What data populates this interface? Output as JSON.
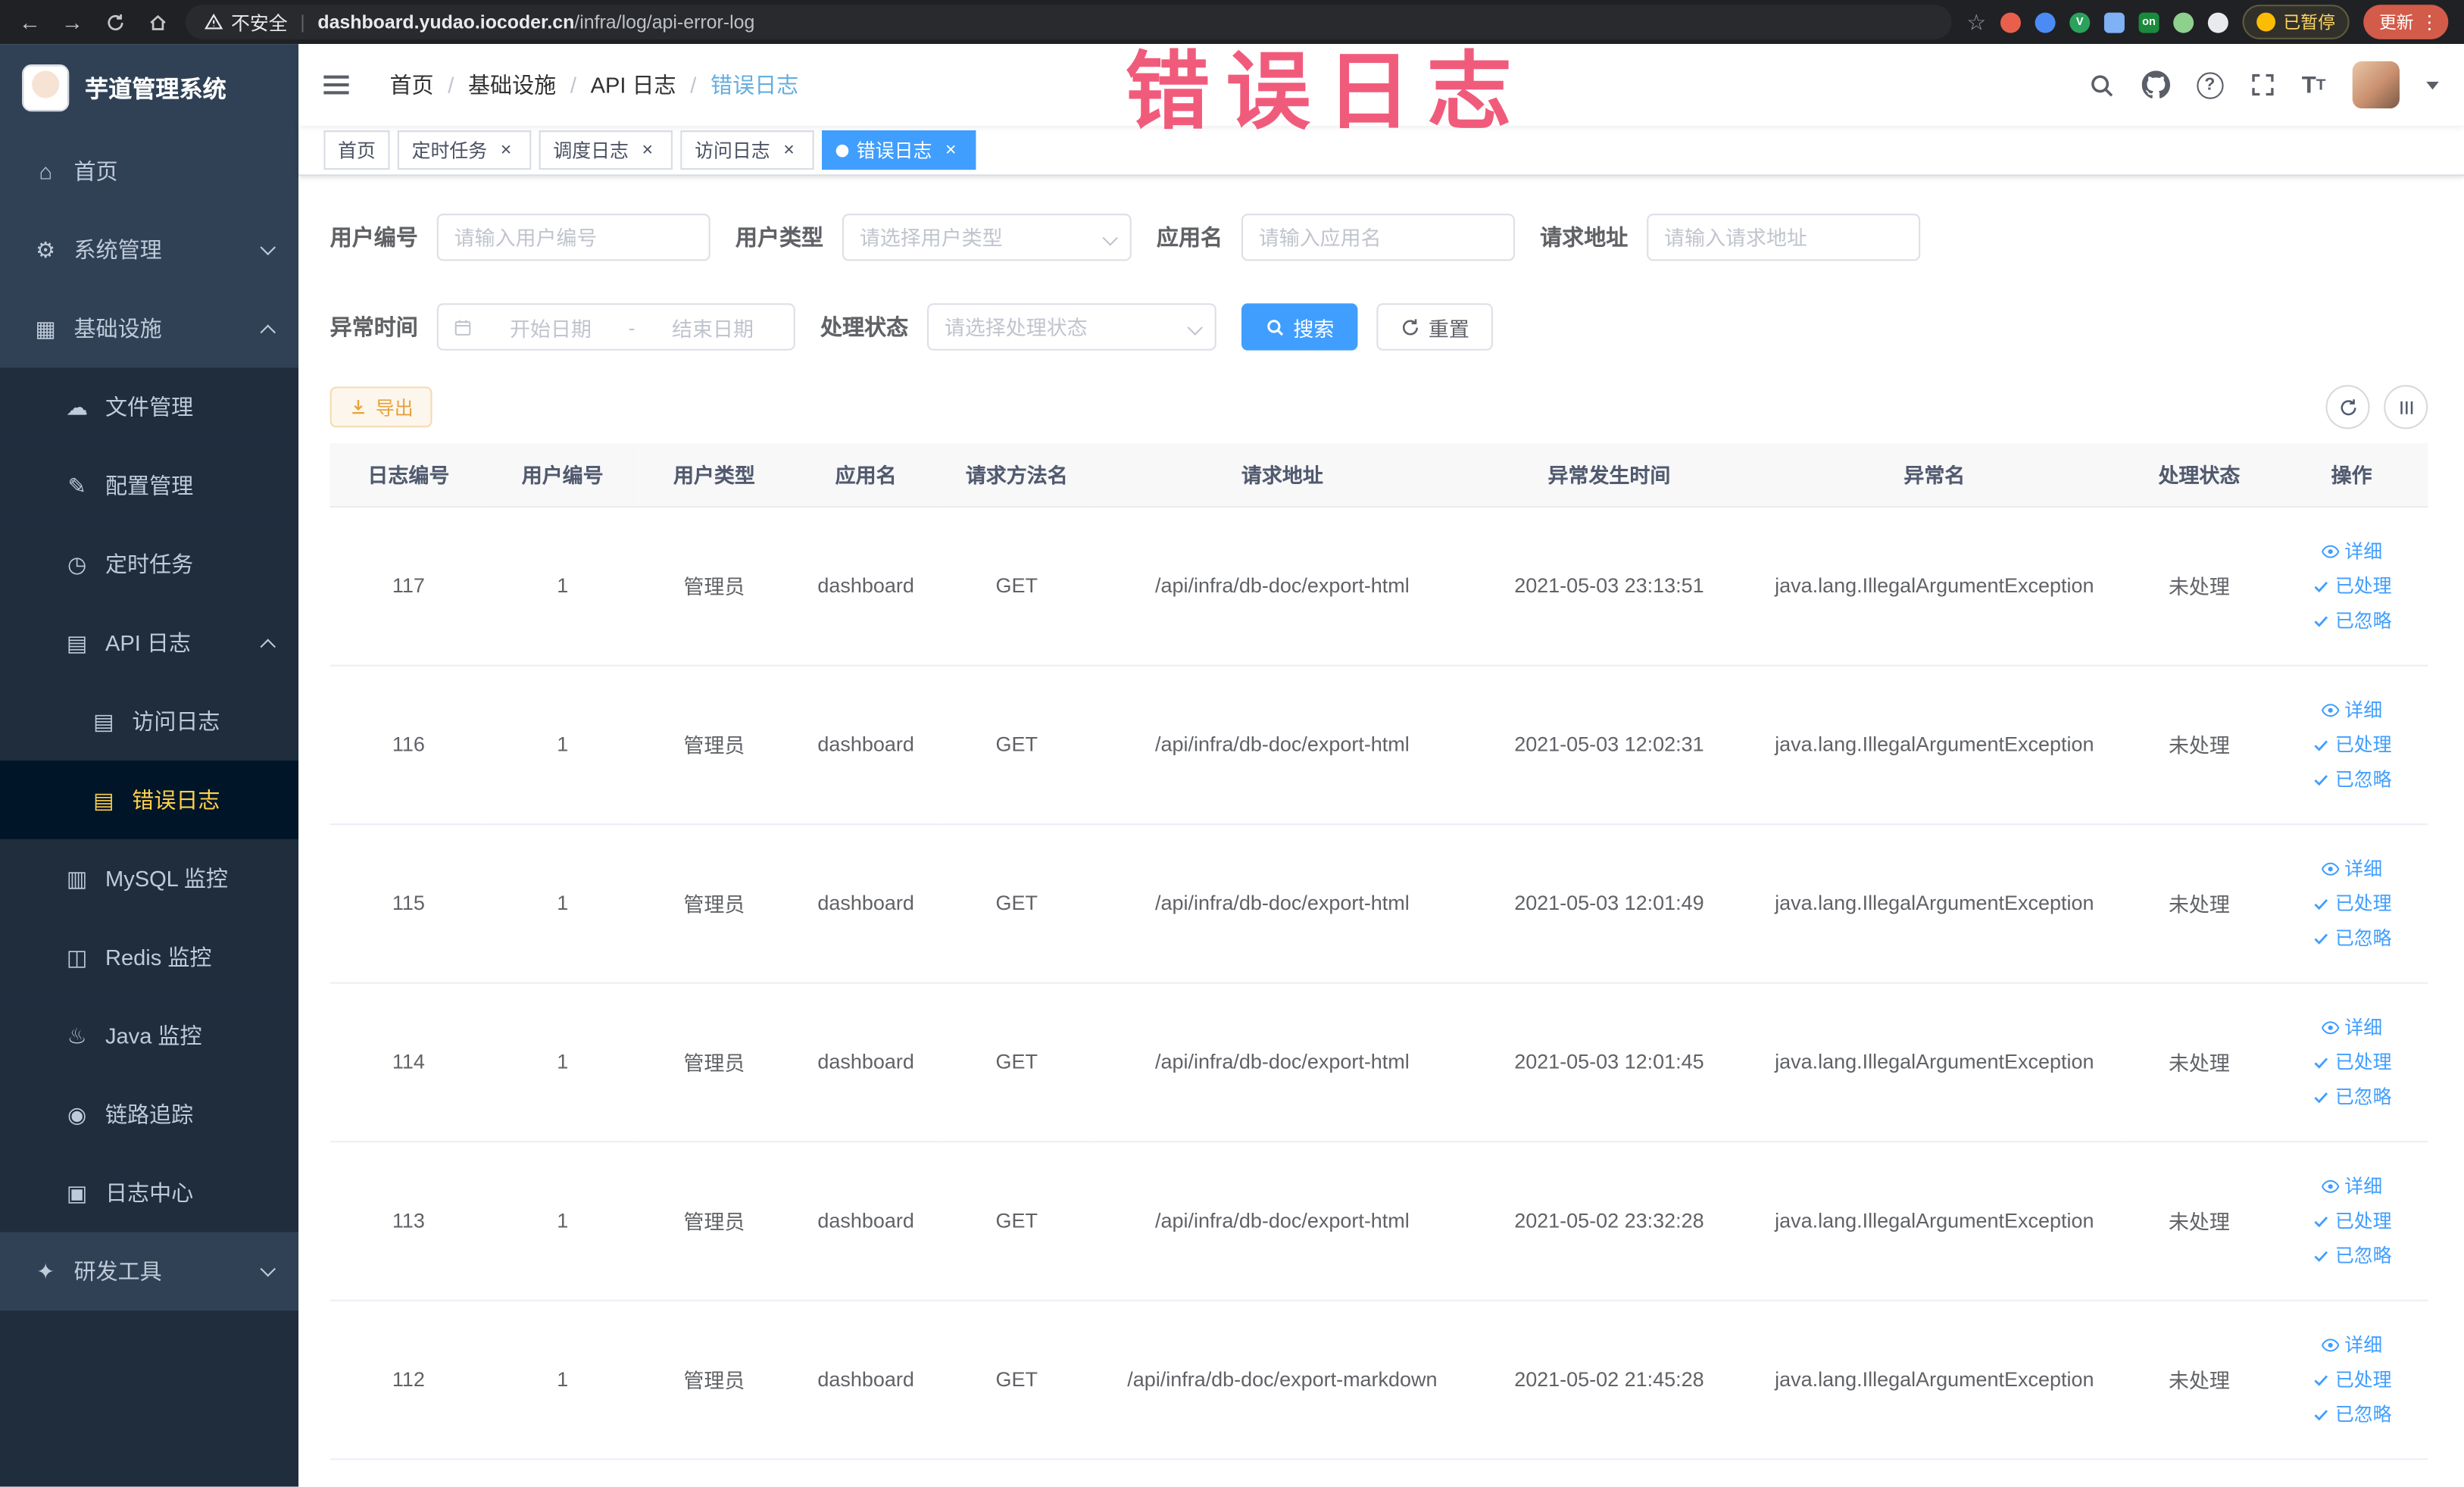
{
  "browser": {
    "security_label": "不安全",
    "url_host": "dashboard.yudao.iocoder.cn",
    "url_path": "/infra/log/api-error-log",
    "paused_chip": "已暂停",
    "update_button": "更新"
  },
  "overlay": {
    "title": "错误日志"
  },
  "app": {
    "title": "芋道管理系统"
  },
  "sidebar": {
    "items": [
      {
        "slug": "home",
        "label": "首页",
        "icon": "home-icon",
        "level": 0
      },
      {
        "slug": "system-management",
        "label": "系统管理",
        "icon": "gear-icon",
        "level": 0,
        "chevron": "down"
      },
      {
        "slug": "infrastructure",
        "label": "基础设施",
        "icon": "infrastructure-icon",
        "level": 0,
        "chevron": "up"
      },
      {
        "slug": "file-management",
        "label": "文件管理",
        "icon": "file-icon",
        "level": 1
      },
      {
        "slug": "config-management",
        "label": "配置管理",
        "icon": "config-icon",
        "level": 1
      },
      {
        "slug": "scheduled-jobs",
        "label": "定时任务",
        "icon": "timer-icon",
        "level": 1
      },
      {
        "slug": "api-logs",
        "label": "API 日志",
        "icon": "api-log-icon",
        "level": 1,
        "chevron": "up"
      },
      {
        "slug": "access-logs",
        "label": "访问日志",
        "icon": "access-log-icon",
        "level": 2
      },
      {
        "slug": "error-logs",
        "label": "错误日志",
        "icon": "error-log-icon",
        "level": 2,
        "active": true
      },
      {
        "slug": "mysql-monitor",
        "label": "MySQL 监控",
        "icon": "mysql-icon",
        "level": 1
      },
      {
        "slug": "redis-monitor",
        "label": "Redis 监控",
        "icon": "redis-icon",
        "level": 1
      },
      {
        "slug": "java-monitor",
        "label": "Java 监控",
        "icon": "java-icon",
        "level": 1
      },
      {
        "slug": "trace",
        "label": "链路追踪",
        "icon": "trace-icon",
        "level": 1
      },
      {
        "slug": "log-center",
        "label": "日志中心",
        "icon": "log-center-icon",
        "level": 1
      },
      {
        "slug": "dev-tools",
        "label": "研发工具",
        "icon": "tools-icon",
        "level": 0,
        "chevron": "down"
      }
    ]
  },
  "header": {
    "breadcrumb": [
      "首页",
      "基础设施",
      "API 日志",
      "错误日志"
    ],
    "breadcrumb_separator": "/"
  },
  "tags": [
    {
      "slug": "home",
      "label": "首页",
      "closable": false,
      "active": false
    },
    {
      "slug": "scheduled-jobs",
      "label": "定时任务",
      "closable": true,
      "active": false
    },
    {
      "slug": "schedule-logs",
      "label": "调度日志",
      "closable": true,
      "active": false
    },
    {
      "slug": "access-logs",
      "label": "访问日志",
      "closable": true,
      "active": false
    },
    {
      "slug": "error-logs",
      "label": "错误日志",
      "closable": true,
      "active": true
    }
  ],
  "filters": {
    "user_id": {
      "label": "用户编号",
      "placeholder": "请输入用户编号"
    },
    "user_type": {
      "label": "用户类型",
      "placeholder": "请选择用户类型"
    },
    "app_name": {
      "label": "应用名",
      "placeholder": "请输入应用名"
    },
    "request_url": {
      "label": "请求地址",
      "placeholder": "请输入请求地址"
    },
    "exception_time": {
      "label": "异常时间",
      "start_placeholder": "开始日期",
      "separator": "-",
      "end_placeholder": "结束日期"
    },
    "process_status": {
      "label": "处理状态",
      "placeholder": "请选择处理状态"
    },
    "search_button": "搜索",
    "reset_button": "重置"
  },
  "toolbar": {
    "export_button": "导出"
  },
  "table": {
    "columns": [
      "日志编号",
      "用户编号",
      "用户类型",
      "应用名",
      "请求方法名",
      "请求地址",
      "异常发生时间",
      "异常名",
      "处理状态",
      "操作"
    ],
    "row_actions": [
      "详细",
      "已处理",
      "已忽略"
    ],
    "rows": [
      {
        "id": "117",
        "user_id": "1",
        "user_type": "管理员",
        "app": "dashboard",
        "method": "GET",
        "url": "/api/infra/db-doc/export-html",
        "time": "2021-05-03 23:13:51",
        "exception": "java.lang.IllegalArgumentException",
        "status": "未处理"
      },
      {
        "id": "116",
        "user_id": "1",
        "user_type": "管理员",
        "app": "dashboard",
        "method": "GET",
        "url": "/api/infra/db-doc/export-html",
        "time": "2021-05-03 12:02:31",
        "exception": "java.lang.IllegalArgumentException",
        "status": "未处理"
      },
      {
        "id": "115",
        "user_id": "1",
        "user_type": "管理员",
        "app": "dashboard",
        "method": "GET",
        "url": "/api/infra/db-doc/export-html",
        "time": "2021-05-03 12:01:49",
        "exception": "java.lang.IllegalArgumentException",
        "status": "未处理"
      },
      {
        "id": "114",
        "user_id": "1",
        "user_type": "管理员",
        "app": "dashboard",
        "method": "GET",
        "url": "/api/infra/db-doc/export-html",
        "time": "2021-05-03 12:01:45",
        "exception": "java.lang.IllegalArgumentException",
        "status": "未处理"
      },
      {
        "id": "113",
        "user_id": "1",
        "user_type": "管理员",
        "app": "dashboard",
        "method": "GET",
        "url": "/api/infra/db-doc/export-html",
        "time": "2021-05-02 23:32:28",
        "exception": "java.lang.IllegalArgumentException",
        "status": "未处理"
      },
      {
        "id": "112",
        "user_id": "1",
        "user_type": "管理员",
        "app": "dashboard",
        "method": "GET",
        "url": "/api/infra/db-doc/export-markdown",
        "time": "2021-05-02 21:45:28",
        "exception": "java.lang.IllegalArgumentException",
        "status": "未处理"
      }
    ]
  },
  "colors": {
    "primary": "#409eff",
    "sidebar_bg": "#304156",
    "submenu_bg": "#1f2d3d",
    "active_menu_text": "#ffd04b",
    "export_warning": "#e6a23c",
    "annotation": "#ee3e64"
  }
}
